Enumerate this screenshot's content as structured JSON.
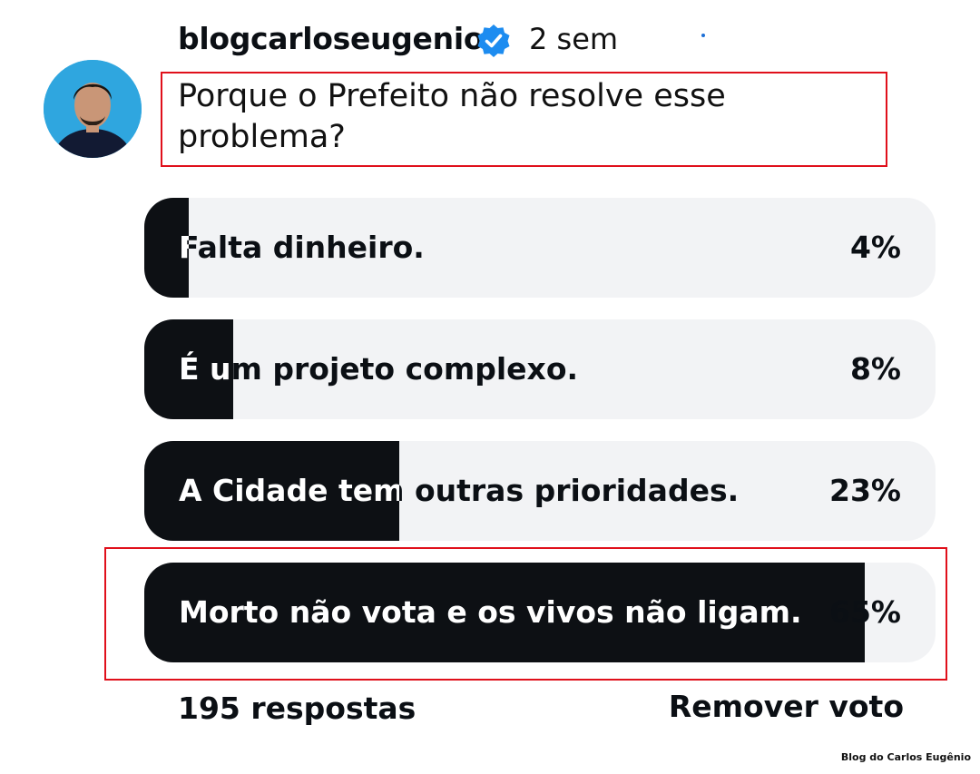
{
  "post": {
    "username": "blogcarloseugenio",
    "time": "2 sem",
    "question": "Porque o Prefeito não resolve esse problema?"
  },
  "poll": {
    "options": [
      {
        "label": "Falta dinheiro.",
        "percent_label": "4%",
        "percent": 4
      },
      {
        "label": "É um projeto complexo.",
        "percent_label": "8%",
        "percent": 8
      },
      {
        "label": "A Cidade tem outras prioridades.",
        "percent_label": "23%",
        "percent": 23
      },
      {
        "label": "Morto não vota e os vivos não ligam.",
        "percent_label": "65%",
        "percent": 65
      }
    ],
    "responses": "195 respostas",
    "remove_vote": "Remover voto"
  },
  "watermark": "Blog do Carlos Eugênio",
  "colors": {
    "fill": "#0d1014",
    "track": "#f2f3f5",
    "highlight": "#e0101b",
    "verified": "#1d8cf0"
  },
  "icons": {
    "verified": "verified-badge-icon",
    "avatar": "profile-avatar"
  }
}
